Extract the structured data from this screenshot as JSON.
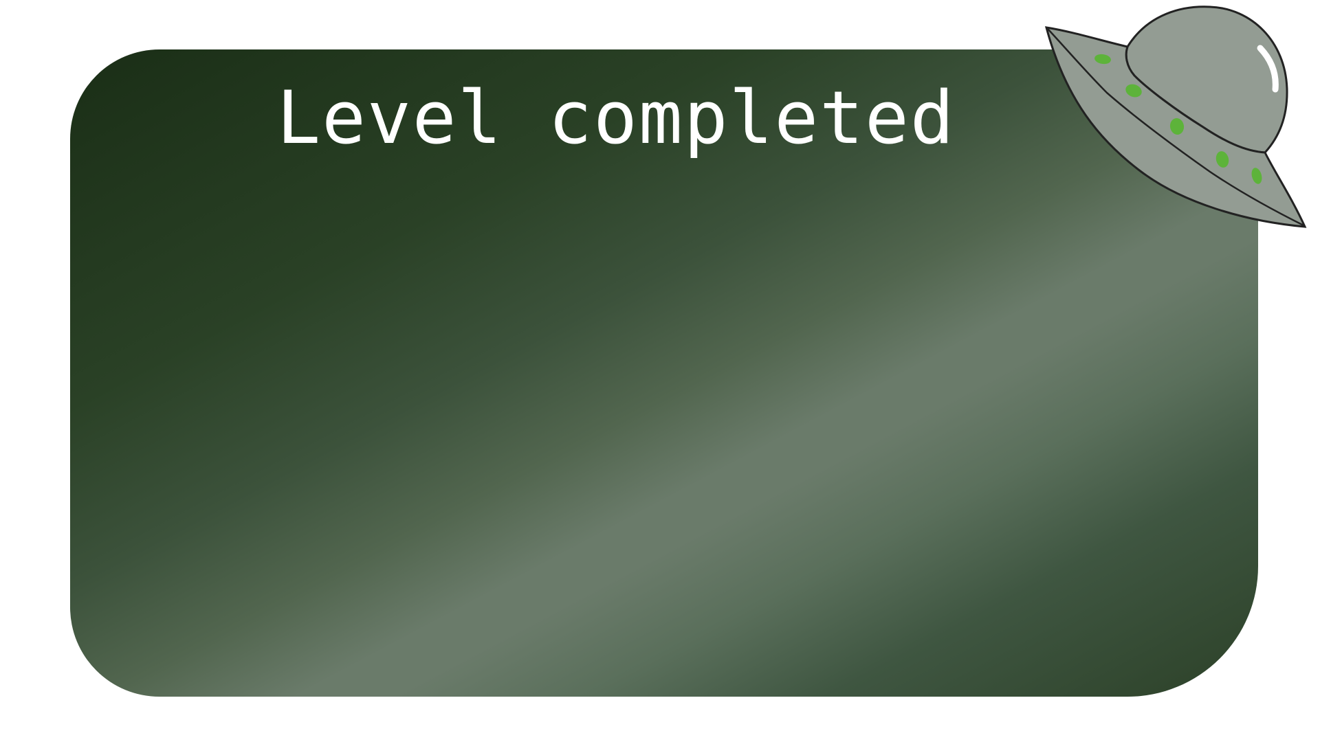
{
  "dialog": {
    "title": "Level completed"
  },
  "decoration": {
    "icon": "ufo-icon",
    "colors": {
      "panel_dark": "#1a2e16",
      "panel_light": "#6a7b6a",
      "ufo_body": "#939c93",
      "ufo_lights": "#5db33a",
      "ufo_outline": "#222222"
    }
  }
}
